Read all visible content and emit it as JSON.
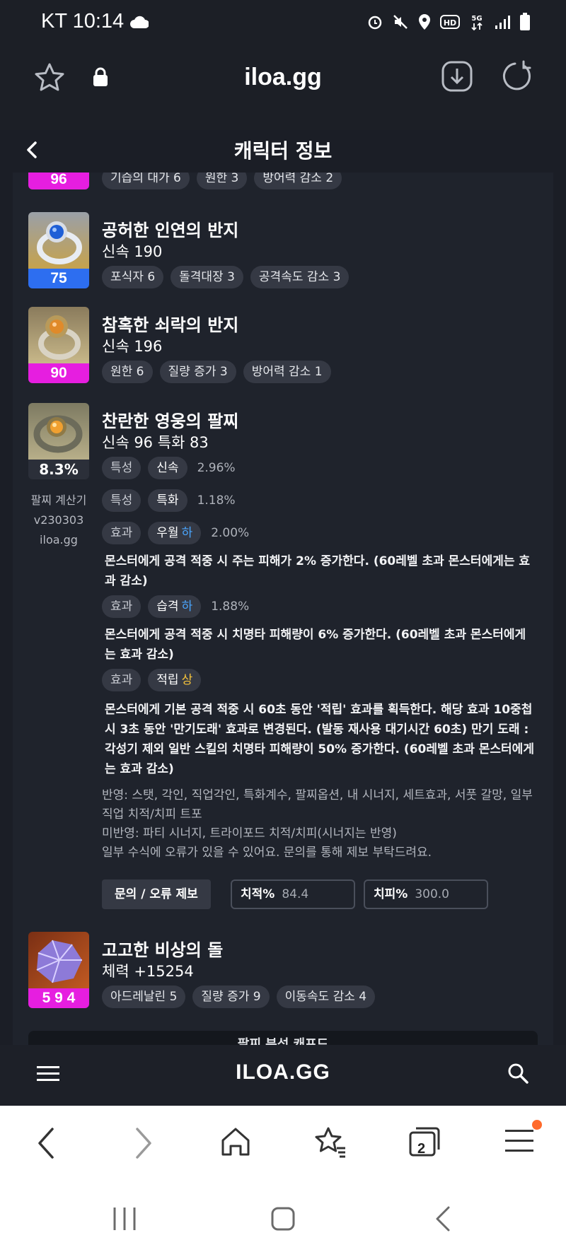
{
  "status_bar": {
    "carrier_time": "KT 10:14",
    "network": "5G"
  },
  "browser": {
    "url": "iloa.gg"
  },
  "header": {
    "title": "캐릭터 정보"
  },
  "items": [
    {
      "name": "",
      "stat": "",
      "badge": "96",
      "badge_color": "#e61ee0",
      "tags": [
        "기습의 대가 6",
        "원한 3",
        "방어력 감소 2"
      ]
    },
    {
      "name": "공허한 인연의 반지",
      "stat": "신속 190",
      "badge": "75",
      "badge_color": "#2d6ef0",
      "tags": [
        "포식자 6",
        "돌격대장 3",
        "공격속도 감소 3"
      ]
    },
    {
      "name": "참혹한 쇠락의 반지",
      "stat": "신속 196",
      "badge": "90",
      "badge_color": "#e61ee0",
      "tags": [
        "원한 6",
        "질량 증가 3",
        "방어력 감소 1"
      ]
    },
    {
      "name": "찬란한 영웅의 팔찌",
      "stat": "신속 96  특화 83",
      "badge": "8.3%",
      "side": [
        "팔찌 계산기",
        "v230303",
        "iloa.gg"
      ],
      "effects": [
        {
          "type": "특성",
          "name": "신속",
          "grade": "",
          "pct": "2.96%",
          "desc": ""
        },
        {
          "type": "특성",
          "name": "특화",
          "grade": "",
          "pct": "1.18%",
          "desc": ""
        },
        {
          "type": "효과",
          "name": "우월",
          "grade": "하",
          "pct": "2.00%",
          "desc": "몬스터에게 공격 적중 시 주는 피해가 2% 증가한다. (60레벨 초과 몬스터에게는 효과 감소)"
        },
        {
          "type": "효과",
          "name": "습격",
          "grade": "하",
          "pct": "1.88%",
          "desc": "몬스터에게 공격 적중 시 치명타 피해량이 6% 증가한다. (60레벨 초과 몬스터에게는 효과 감소)"
        },
        {
          "type": "효과",
          "name": "적립",
          "grade": "상",
          "pct": "",
          "desc": "몬스터에게 기본 공격 적중 시 60초 동안 '적립' 효과를 획득한다. 해당 효과 10중첩 시 3초 동안 '만기도래' 효과로 변경된다. (발동 재사용 대기시간 60초) 만기 도래 : 각성기 제외 일반 스킬의 치명타 피해량이 50% 증가한다. (60레벨 초과 몬스터에게는 효과 감소)"
        }
      ],
      "notes": [
        "반영: 스탯, 각인, 직업각인, 특화계수, 팔찌옵션, 내 시너지, 세트효과, 서풋 갈망, 일부 직업 치적/치피 트포",
        "미반영: 파티 시너지, 트라이포드 치적/치피(시너지는 반영)",
        "일부 수식에 오류가 있을 수 있어요. 문의를 통해 제보 부탁드려요."
      ],
      "report_button": "문의 / 오류 제보",
      "crit_rate": {
        "label": "치적%",
        "value": "84.4"
      },
      "crit_dmg": {
        "label": "치피%",
        "value": "300.0"
      }
    },
    {
      "name": "고고한 비상의 돌",
      "stat": "체력 +15254",
      "badge": "5 9 4",
      "badge_color": "#e61ee0",
      "tags": [
        "아드레날린 5",
        "질량 증가 9",
        "이동속도 감소 4"
      ]
    }
  ],
  "next_section": "팔찌 분석 캐프드",
  "site_bar": {
    "logo": "ILOA.GG"
  },
  "toolbar": {
    "tab_count": "2"
  }
}
